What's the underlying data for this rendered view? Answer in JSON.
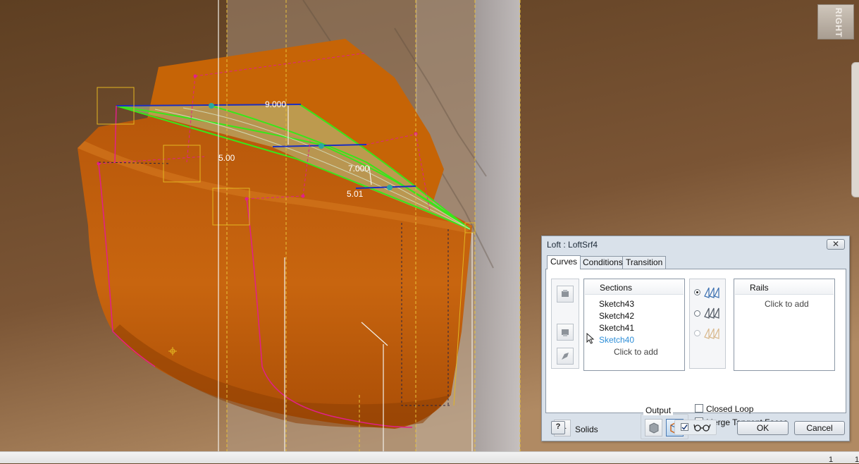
{
  "viewport": {
    "viewcube_label": "RIGHT",
    "dimensions": [
      "9.000",
      "5.00",
      "7.000",
      "5.01"
    ]
  },
  "dialog": {
    "title": "Loft : LoftSrf4",
    "close_icon": "close-x-icon",
    "tabs": [
      {
        "label": "Curves",
        "active": true
      },
      {
        "label": "Conditions",
        "active": false
      },
      {
        "label": "Transition",
        "active": false
      }
    ],
    "sections": {
      "header": "Sections",
      "items": [
        {
          "label": "Sketch43",
          "selected": false
        },
        {
          "label": "Sketch42",
          "selected": false
        },
        {
          "label": "Sketch41",
          "selected": false
        },
        {
          "label": "Sketch40",
          "selected": true
        }
      ],
      "add_prompt": "Click to add"
    },
    "rails": {
      "header": "Rails",
      "add_prompt": "Click to add"
    },
    "solids_label": "Solids",
    "output_label": "Output",
    "closed_loop_label": "Closed Loop",
    "merge_tangent_faces_label": "Merge Tangent Faces",
    "help_label": "?",
    "ok_label": "OK",
    "cancel_label": "Cancel",
    "colors": {
      "selected_text": "#2f8fd8",
      "surface": "#c9620a",
      "preview_edge": "#39e61a",
      "sketch": "#e0208a"
    }
  },
  "statusbar": {
    "value_1": "1",
    "value_2": "1"
  }
}
